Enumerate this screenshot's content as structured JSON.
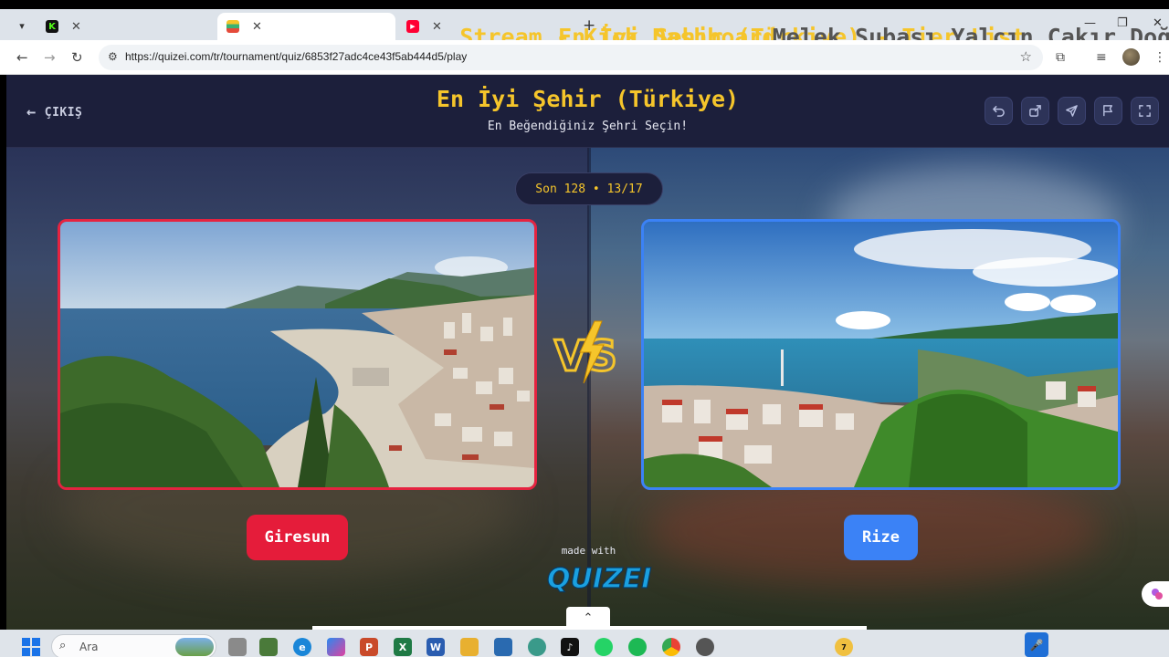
{
  "browser": {
    "tabs": [
      {
        "title": "Stream - Kick Dashboard",
        "favicon": "kick-icon",
        "color": "#53fc18"
      },
      {
        "title": "En İyi Şehir (Türkiye) - Tier List,",
        "favicon": "quizei-icon",
        "color": "#f5c52b"
      },
      {
        "title": "Melek Subaşı Yalçın Çakır Doğu",
        "favicon": "youtube-icon",
        "color": "#ff0033"
      }
    ],
    "close_glyph": "✕",
    "new_tab_glyph": "+",
    "url": "https://quizei.com/tr/tournament/quiz/6853f27adc4ce43f5ab444d5/play"
  },
  "header": {
    "exit_label": "ÇIKIŞ",
    "title": "En İyi Şehir (Türkiye)",
    "subtitle": "En Beğendiğiniz Şehri Seçin!",
    "actions": [
      "undo-icon",
      "share-icon",
      "send-icon",
      "flag-icon",
      "fullscreen-icon"
    ]
  },
  "round": {
    "label": "Son 128 • 13/17"
  },
  "matchup": {
    "left": {
      "name": "Giresun",
      "color": "#e51c3a"
    },
    "right": {
      "name": "Rize",
      "color": "#3b82f6"
    },
    "vs_label": "VS"
  },
  "footer": {
    "made_with": "made with",
    "brand": "QUIZEI"
  },
  "taskbar": {
    "search_placeholder": "Ara",
    "notification_count": "7"
  },
  "colors": {
    "accent_yellow": "#f5c52b",
    "header_bg": "#1c1f3b",
    "left_red": "#e51c3a",
    "right_blue": "#3b82f6"
  }
}
